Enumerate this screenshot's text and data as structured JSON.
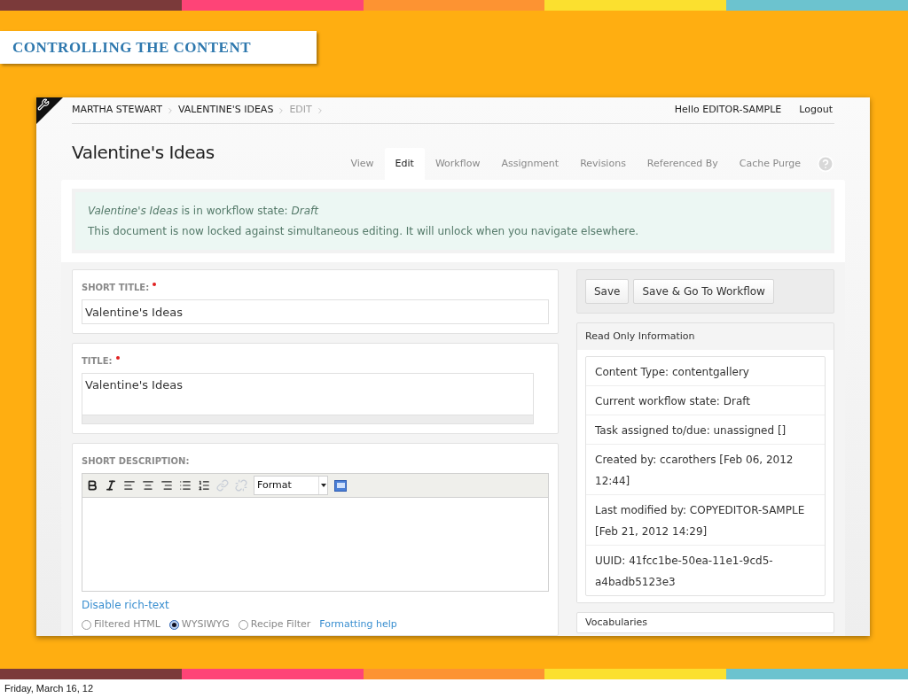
{
  "slide_title": "CONTROLLING THE CONTENT",
  "breadcrumbs": [
    {
      "label": "MARTHA STEWART",
      "current": false
    },
    {
      "label": "VALENTINE'S IDEAS",
      "current": false
    },
    {
      "label": "EDIT",
      "current": true
    }
  ],
  "user_greeting": "Hello EDITOR-SAMPLE",
  "logout": "Logout",
  "page_title": "Valentine's Ideas",
  "tabs": [
    {
      "label": "View",
      "selected": false
    },
    {
      "label": "Edit",
      "selected": true
    },
    {
      "label": "Workflow",
      "selected": false
    },
    {
      "label": "Assignment",
      "selected": false
    },
    {
      "label": "Revisions",
      "selected": false
    },
    {
      "label": "Referenced By",
      "selected": false
    },
    {
      "label": "Cache Purge",
      "selected": false
    }
  ],
  "notice": [
    "*Valentine's Ideas* is in workflow state: *Draft*",
    "This document is now locked against simultaneous editing. It will unlock when you navigate elsewhere."
  ],
  "short_title": {
    "label": "SHORT TITLE:",
    "required": true,
    "value": "Valentine's Ideas"
  },
  "title": {
    "label": "TITLE:",
    "required": true,
    "value": "Valentine's Ideas"
  },
  "short_description": {
    "label": "SHORT DESCRIPTION:",
    "required": false,
    "format_select": "Format",
    "toggle_link": "Disable rich-text",
    "input_formats": [
      {
        "label": "Filtered HTML",
        "selected": false
      },
      {
        "label": "WYSIWYG",
        "selected": true
      },
      {
        "label": "Recipe Filter",
        "selected": false
      }
    ],
    "help_link": "Formatting help"
  },
  "buttons": [
    "Save",
    "Save & Go To Workflow"
  ],
  "read_only": {
    "heading": "Read Only Information",
    "items": [
      "Content Type: contentgallery",
      "Current workflow state: Draft",
      "Task assigned to/due: unassigned []",
      "Created by: ccarothers [Feb 06, 2012 12:44]",
      "Last modified by: COPYEDITOR-SAMPLE [Feb 21, 2012 14:29]",
      "UUID: 41fcc1be-50ea-11e1-9cd5-a4badb5123e3"
    ]
  },
  "vocabularies": {
    "heading": "Vocabularies"
  },
  "footer_date": "Friday, March 16, 12"
}
